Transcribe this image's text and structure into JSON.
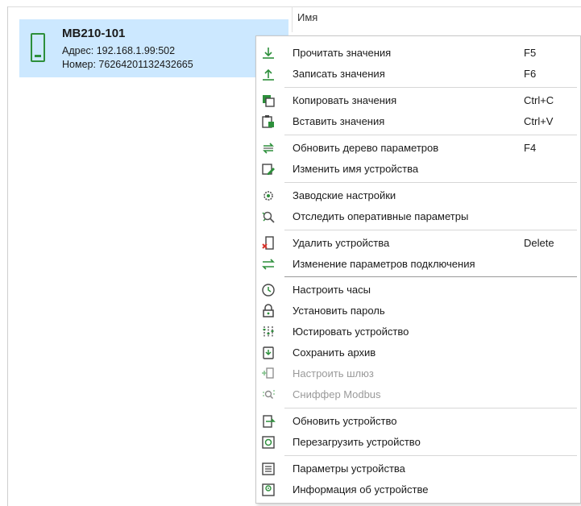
{
  "device": {
    "name": "МВ210-101",
    "address": "Адрес: 192.168.1.99:502",
    "number": "Номер: 76264201132432665"
  },
  "table": {
    "header": "Имя"
  },
  "context_menu": {
    "items": [
      {
        "label": "Прочитать значения",
        "shortcut": "F5",
        "icon": "download-arrow-icon",
        "enabled": true
      },
      {
        "label": "Записать значения",
        "shortcut": "F6",
        "icon": "upload-arrow-icon",
        "enabled": true
      },
      {
        "label": "Копировать значения",
        "shortcut": "Ctrl+C",
        "icon": "copy-icon",
        "enabled": true
      },
      {
        "label": "Вставить значения",
        "shortcut": "Ctrl+V",
        "icon": "paste-icon",
        "enabled": true
      },
      {
        "label": "Обновить дерево параметров",
        "shortcut": "F4",
        "icon": "refresh-tree-icon",
        "enabled": true
      },
      {
        "label": "Изменить имя устройства",
        "shortcut": "",
        "icon": "rename-icon",
        "enabled": true
      },
      {
        "label": "Заводские настройки",
        "shortcut": "",
        "icon": "factory-settings-gear-icon",
        "enabled": true
      },
      {
        "label": "Отследить оперативные параметры",
        "shortcut": "",
        "icon": "track-parameters-icon",
        "enabled": true
      },
      {
        "label": "Удалить устройства",
        "shortcut": "Delete",
        "icon": "delete-device-icon",
        "enabled": true
      },
      {
        "label": "Изменение параметров подключения",
        "shortcut": "",
        "icon": "connection-arrows-icon",
        "enabled": true
      },
      {
        "label": "Настроить часы",
        "shortcut": "",
        "icon": "clock-icon",
        "enabled": true
      },
      {
        "label": "Установить пароль",
        "shortcut": "",
        "icon": "password-lock-icon",
        "enabled": true
      },
      {
        "label": "Юстировать устройство",
        "shortcut": "",
        "icon": "calibrate-icon",
        "enabled": true
      },
      {
        "label": "Сохранить архив",
        "shortcut": "",
        "icon": "archive-icon",
        "enabled": true
      },
      {
        "label": "Настроить шлюз",
        "shortcut": "",
        "icon": "gateway-icon",
        "enabled": false
      },
      {
        "label": "Сниффер Modbus",
        "shortcut": "",
        "icon": "sniffer-icon",
        "enabled": false
      },
      {
        "label": "Обновить устройство",
        "shortcut": "",
        "icon": "update-device-icon",
        "enabled": true
      },
      {
        "label": "Перезагрузить устройство",
        "shortcut": "",
        "icon": "reboot-device-icon",
        "enabled": true
      },
      {
        "label": "Параметры устройства",
        "shortcut": "",
        "icon": "device-parameters-icon",
        "enabled": true
      },
      {
        "label": "Информация об устройстве",
        "shortcut": "",
        "icon": "device-info-icon",
        "enabled": true
      }
    ]
  },
  "colors": {
    "selection": "#cce8ff",
    "icon_green": "#2d8f3b",
    "icon_gray": "#555555",
    "delete_red": "#d8342c",
    "disabled_text": "#9a9a9a"
  }
}
